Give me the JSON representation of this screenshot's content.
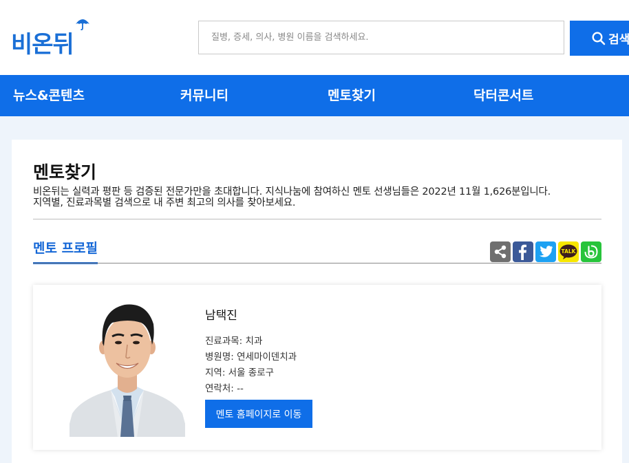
{
  "header": {
    "logo_text": "비온뒤",
    "search_placeholder": "질병, 증세, 의사, 병원 이름을 검색하세요.",
    "search_button_label": "검색"
  },
  "nav": {
    "items": [
      {
        "label": "뉴스&콘텐츠"
      },
      {
        "label": "커뮤니티"
      },
      {
        "label": "멘토찾기"
      },
      {
        "label": "닥터콘서트"
      }
    ]
  },
  "page": {
    "title": "멘토찾기",
    "desc_line1": "비온뒤는 실력과 평판 등 검증된 전문가만을 초대합니다. 지식나눔에 참여하신 멘토 선생님들은 2022년 11월 1,626분입니다.",
    "desc_line2": "지역별, 진료과목별 검색으로 내 주변 최고의 의사를 찾아보세요.",
    "section_tab": "멘토 프로필"
  },
  "share": {
    "icons": [
      "share-icon",
      "facebook-icon",
      "twitter-icon",
      "kakaotalk-icon",
      "band-icon"
    ],
    "kakao_text": "TALK",
    "colors": {
      "share": "#6f6f6f",
      "facebook": "#3b5998",
      "twitter": "#1da1f2",
      "kakao": "#f7e600",
      "band": "#27c43b"
    }
  },
  "profile": {
    "name": "남택진",
    "department": "진료과목: 치과",
    "hospital": "병원명: 연세마이덴치과",
    "region": "지역: 서울 종로구",
    "contact": "연락처: --",
    "button_label": "멘토 홈페이지로 이동"
  },
  "colors": {
    "primary": "#0f6ee8",
    "background": "#eef4fb"
  }
}
